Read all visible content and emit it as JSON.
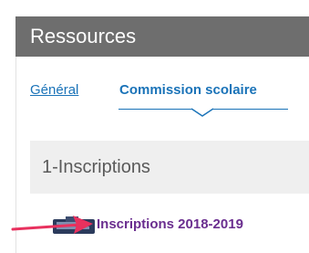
{
  "header": {
    "title": "Ressources"
  },
  "tabs": [
    {
      "label": "Général"
    },
    {
      "label": "Commission scolaire"
    }
  ],
  "section": {
    "title": "1-Inscriptions"
  },
  "resources": [
    {
      "label": "Inscriptions 2018-2019"
    }
  ],
  "colors": {
    "header_bg": "#6e6e6e",
    "tab_link": "#1a73b8",
    "resource_link": "#6a2e8f",
    "annotation_arrow": "#e8315e"
  },
  "icons": {
    "resource_icon": "document-icon",
    "pointer": "arrow-annotation-icon",
    "active_tab": "caret-icon"
  }
}
